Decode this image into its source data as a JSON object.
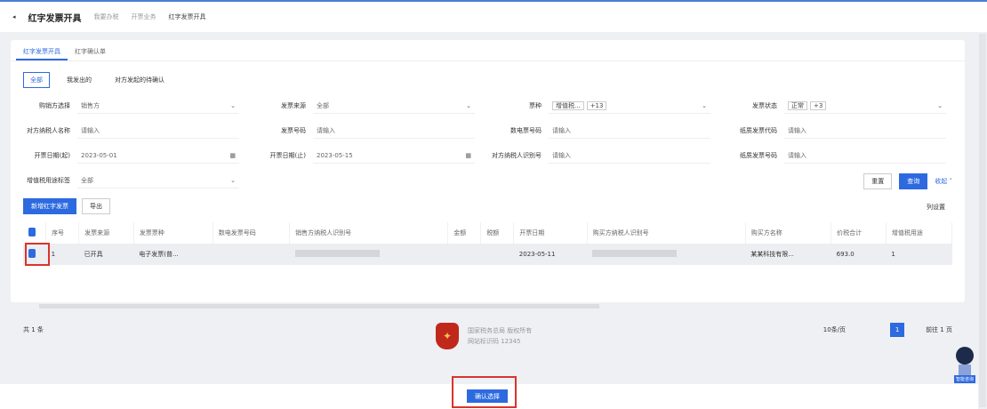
{
  "header": {
    "back_icon": "arrow-left-icon",
    "title": "红字发票开具",
    "breadcrumbs": [
      "我要办税",
      "开票业务",
      "红字发票开具"
    ]
  },
  "tabs": [
    {
      "label": "红字发票开具",
      "active": true
    },
    {
      "label": "红字确认单"
    }
  ],
  "subtabs": [
    {
      "label": "全部",
      "active": true
    },
    {
      "label": "我发出的",
      "active": false
    },
    {
      "label": "对方发起的待确认",
      "active": false
    }
  ],
  "form": {
    "fields": [
      {
        "label": "购销方选择",
        "value": "销售方",
        "type": "select"
      },
      {
        "label": "发票来源",
        "value": "全部",
        "type": "select"
      },
      {
        "label": "票种",
        "tags": [
          "增值税...",
          "+13"
        ],
        "type": "select"
      },
      {
        "label": "发票状态",
        "tags": [
          "正常",
          "+3"
        ],
        "type": "select"
      },
      {
        "label": "对方纳税人名称",
        "value": "请输入",
        "type": "input"
      },
      {
        "label": "发票号码",
        "value": "请输入",
        "type": "input"
      },
      {
        "label": "数电票号码",
        "value": "请输入",
        "type": "input"
      },
      {
        "label": "纸质发票代码",
        "value": "请输入",
        "type": "input"
      },
      {
        "label": "开票日期(起)",
        "value": "2023-05-01",
        "type": "date"
      },
      {
        "label": "开票日期(止)",
        "value": "2023-05-15",
        "type": "date"
      },
      {
        "label": "对方纳税人识别号",
        "value": "请输入",
        "type": "input"
      },
      {
        "label": "纸质发票号码",
        "value": "请输入",
        "type": "input"
      },
      {
        "label": "增值税用途标签",
        "value": "全部",
        "type": "select"
      }
    ],
    "reset": "重置",
    "query": "查询",
    "expand": "收起"
  },
  "actions": {
    "new_red": "新增红字发票",
    "export": "导出",
    "column_settings": "列设置"
  },
  "table": {
    "headers": [
      "",
      "序号",
      "发票来源",
      "发票票种",
      "数电发票号码",
      "销售方纳税人识别号",
      "开票日期",
      "金额",
      "税额",
      "开票日期",
      "购买方纳税人识别号",
      "购买方名称",
      "价税合计",
      "增值税用途"
    ],
    "rows": [
      {
        "index": "1",
        "source": "已开具",
        "kind": "电子发票(普...",
        "invoice_no": "",
        "date": "2023-05-11",
        "buyer": "某某科技有限...",
        "total": "693.0",
        "status": "1"
      }
    ]
  },
  "pagination": {
    "total": "共 1 条",
    "page_size": "10条/页",
    "current": "1",
    "goto": "前往",
    "goto_page": "1",
    "unit": "页"
  },
  "footer": {
    "line1": "国家税务总局  版权所有",
    "line2": "网站标识码  12345"
  },
  "bottom": {
    "submit": "确认选择"
  },
  "mascot": {
    "label": "智能咨询"
  },
  "colors": {
    "accent": "#2d6ae0",
    "highlight": "#d9342b"
  }
}
